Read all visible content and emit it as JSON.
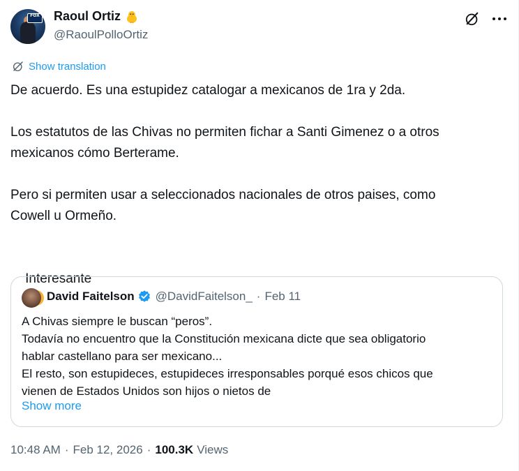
{
  "author": {
    "display_name": "Raoul Ortiz",
    "handle": "@RaoulPolloOrtiz",
    "avatar_badge": "FOX",
    "name_emoji_icon": "baby-chick-icon"
  },
  "actions": {
    "grok_icon": "grok-slash-circle-icon",
    "more_icon": "more-dots-icon"
  },
  "translate": {
    "label": "Show translation",
    "icon": "translate-icon"
  },
  "tweet": {
    "paragraphs": [
      "De acuerdo. Es una estupidez catalogar a mexicanos de 1ra y 2da.",
      "Los estatutos de las Chivas no permiten fichar a Santi Gimenez o a otros\nmexicanos cómo Berterame.",
      "Pero si permiten usar a seleccionados nacionales de otros paises, como\nCowell u Ormeño.",
      "Interesante"
    ],
    "end_emoji_icon": "thinking-face-icon"
  },
  "quote": {
    "author_name": "David Faitelson",
    "verified_icon": "verified-badge-icon",
    "handle": "@DavidFaitelson_",
    "separator": "·",
    "date": "Feb 11",
    "lines": [
      "A Chivas siempre le buscan “peros”.",
      "Todavía no encuentro que la Constitución mexicana dicte que sea obligatorio",
      "hablar castellano para ser mexicano...",
      "El resto, son estupideces, estupideces irresponsables porqué esos chicos que",
      "vienen de Estados Unidos son hijos o nietos de"
    ],
    "show_more": "Show more"
  },
  "meta": {
    "time": "10:48 AM",
    "separator": "·",
    "date": "Feb 12, 2026",
    "views_count": "100.3K",
    "views_label": "Views"
  },
  "colors": {
    "accent": "#1d9bf0",
    "text": "#0f1419",
    "secondary": "#536471",
    "border": "#cfd9de"
  }
}
